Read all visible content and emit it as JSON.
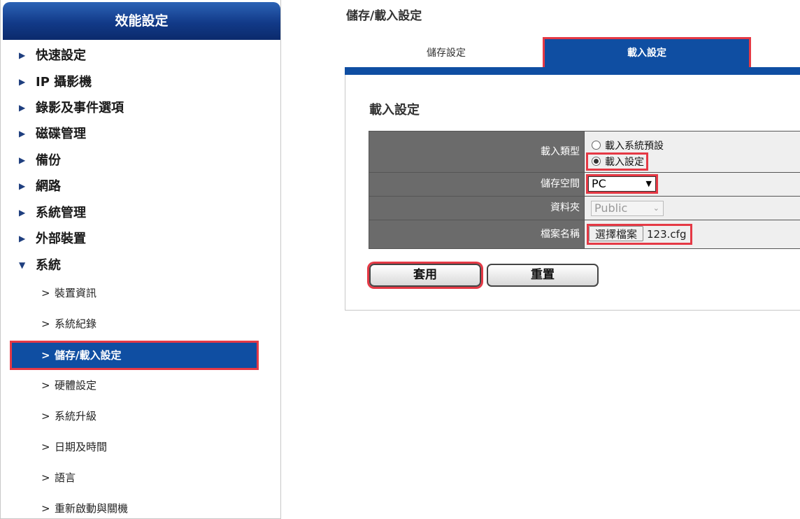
{
  "sidebar": {
    "title": "效能設定",
    "menu": [
      {
        "label": "快速設定",
        "arrow": "▶"
      },
      {
        "label": "IP 攝影機",
        "arrow": "▶"
      },
      {
        "label": "錄影及事件選項",
        "arrow": "▶"
      },
      {
        "label": "磁碟管理",
        "arrow": "▶"
      },
      {
        "label": "備份",
        "arrow": "▶"
      },
      {
        "label": "網路",
        "arrow": "▶"
      },
      {
        "label": "系統管理",
        "arrow": "▶"
      },
      {
        "label": "外部裝置",
        "arrow": "▶"
      },
      {
        "label": "系統",
        "arrow": "▼"
      }
    ],
    "submenu": [
      {
        "label": "裝置資訊"
      },
      {
        "label": "系統紀錄"
      },
      {
        "label": "儲存/載入設定",
        "active": true
      },
      {
        "label": "硬體設定"
      },
      {
        "label": "系統升級"
      },
      {
        "label": "日期及時間"
      },
      {
        "label": "語言"
      },
      {
        "label": "重新啟動與關機"
      }
    ],
    "sub_prefix": ">"
  },
  "main": {
    "page_title": "儲存/載入設定",
    "tabs": [
      {
        "label": "儲存設定"
      },
      {
        "label": "載入設定",
        "active": true
      }
    ],
    "section_title": "載入設定",
    "form": {
      "load_type_label": "載入類型",
      "load_type_options": [
        "載入系統預設",
        "載入設定"
      ],
      "load_type_selected": "載入設定",
      "storage_label": "儲存空間",
      "storage_value": "PC",
      "folder_label": "資料夾",
      "folder_value": "Public",
      "filename_label": "檔案名稱",
      "file_button_label": "選擇檔案",
      "file_name": "123.cfg"
    },
    "buttons": {
      "apply": "套用",
      "reset": "重置"
    }
  },
  "colors": {
    "accent": "#0f4ea2",
    "highlight": "#e53945",
    "label_bg": "#6b6b6b"
  }
}
